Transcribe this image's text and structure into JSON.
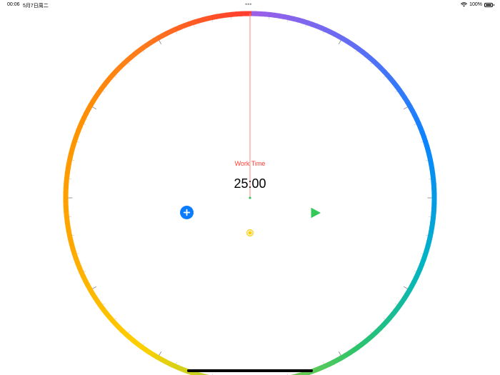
{
  "status_bar": {
    "time": "00:06",
    "date": "5月7日周二",
    "dots": "•••",
    "battery": "100%"
  },
  "timer": {
    "label": "Work Time",
    "time": "25:00"
  },
  "icons": {
    "add": "plus-circle-icon",
    "play": "play-triangle-icon",
    "mode": "sun-dot-icon"
  },
  "colors": {
    "label": "#ff3b30",
    "add_button": "#0a7cff",
    "play_button": "#34c759",
    "mode_dot": "#ffcc00",
    "hand": "#ff8a80",
    "ring_stops": [
      "#9c5fe6",
      "#5b6ef5",
      "#0a84ff",
      "#00b3c8",
      "#2cc46b",
      "#9bd13a",
      "#ffd000",
      "#ffaa00",
      "#ff9500",
      "#ff7a1a",
      "#ff3b30"
    ]
  }
}
